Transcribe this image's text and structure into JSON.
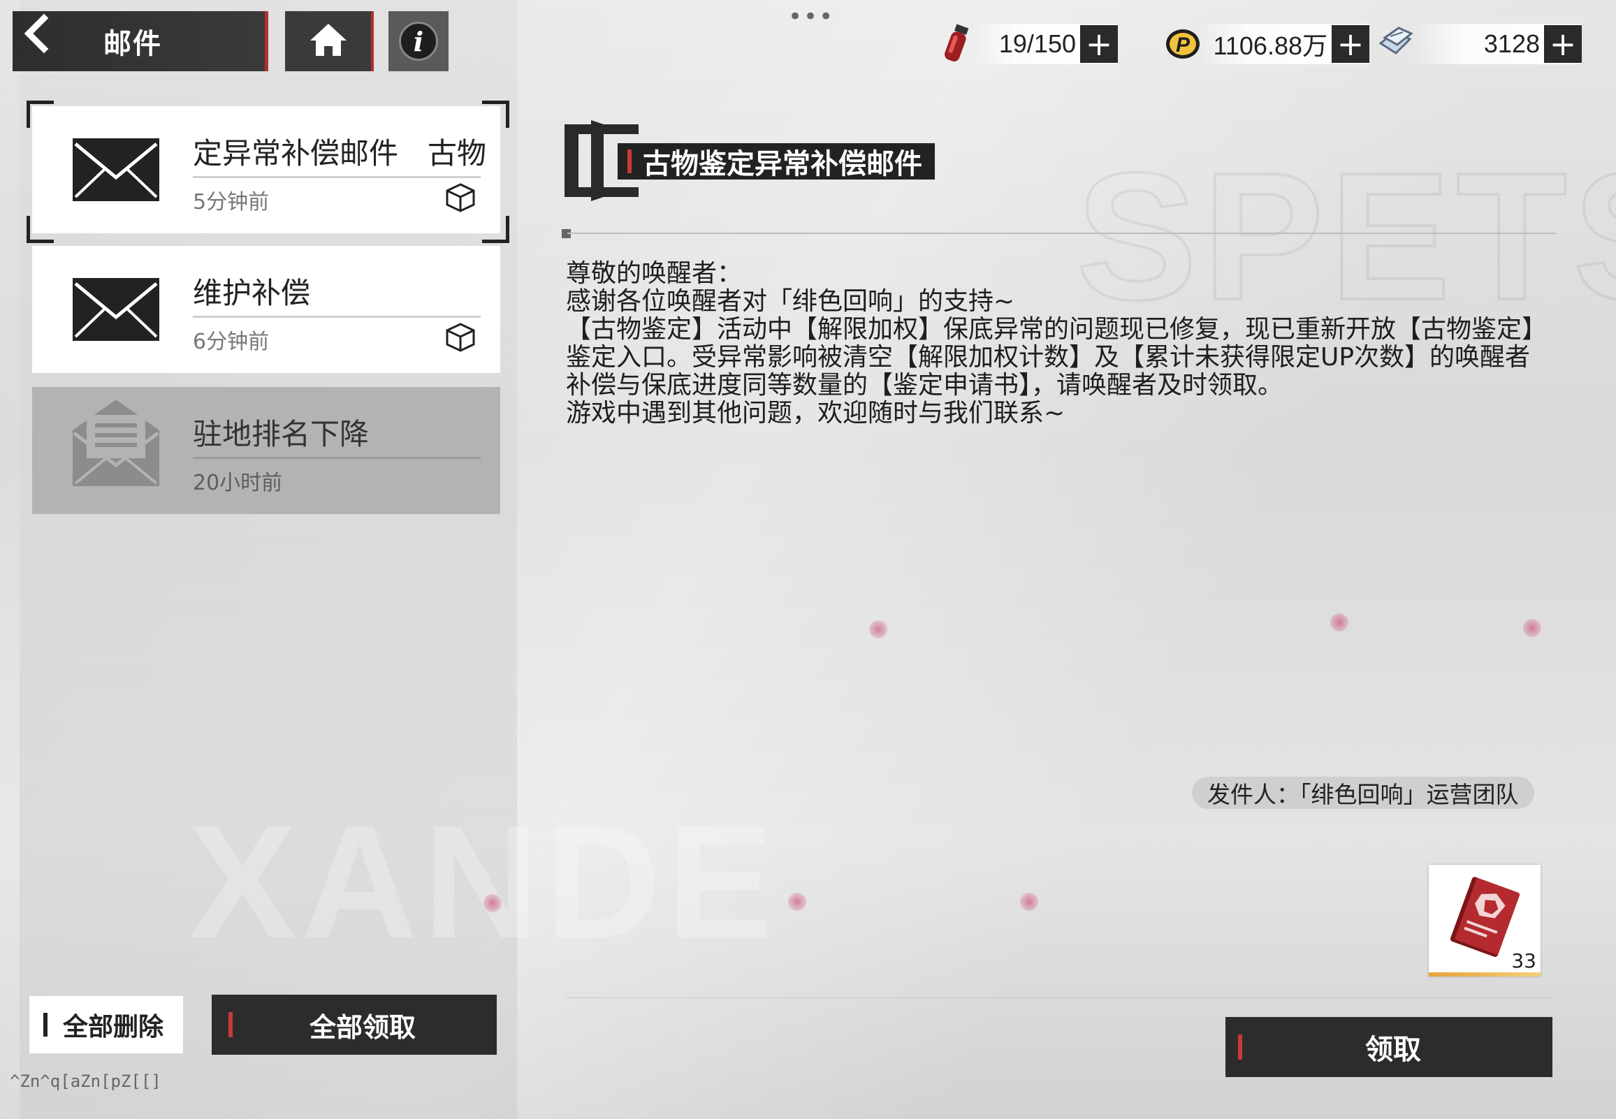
{
  "header": {
    "back_label": "邮件",
    "icons": {
      "back": "chevron-left-icon",
      "home": "home-icon",
      "info": "info-icon"
    }
  },
  "resources": [
    {
      "icon": "stamina-vial-icon",
      "value": "19/150"
    },
    {
      "icon": "coin-icon",
      "value": "1106.88万"
    },
    {
      "icon": "crystal-icon",
      "value": "3128"
    }
  ],
  "mail_list": [
    {
      "title": "古物鉴定异常补偿邮件",
      "title_display": "定异常补偿邮件　古物",
      "time": "5分钟前",
      "state": "selected",
      "has_attachment": true
    },
    {
      "title": "维护补偿",
      "time": "6分钟前",
      "state": "unread",
      "has_attachment": true
    },
    {
      "title": "驻地排名下降",
      "time": "20小时前",
      "state": "read",
      "has_attachment": false
    }
  ],
  "actions": {
    "delete_all": "全部删除",
    "claim_all": "全部领取",
    "claim": "领取"
  },
  "detail": {
    "title": "古物鉴定异常补偿邮件",
    "body": [
      "尊敬的唤醒者：",
      "感谢各位唤醒者对「绯色回响」的支持~",
      "【古物鉴定】活动中【解限加权】保底异常的问题现已修复，现已重新开放【古物鉴定】鉴定入口。受异常影响被清空【解限加权计数】及【累计未获得限定UP次数】的唤醒者补偿与保底进度同等数量的【鉴定申请书】，请唤醒者及时领取。",
      "游戏中遇到其他问题，欢迎随时与我们联系~"
    ],
    "sender": "发件人：「绯色回响」运营团队",
    "attachments": [
      {
        "icon": "appraisal-book-icon",
        "count": "33"
      }
    ]
  },
  "debug_text": "^Zn^q[aZn[pZ[[]",
  "colors": {
    "accent": "#c83a3a",
    "button_dark": "#2c2c2c",
    "rarity": "#e7a23a"
  }
}
